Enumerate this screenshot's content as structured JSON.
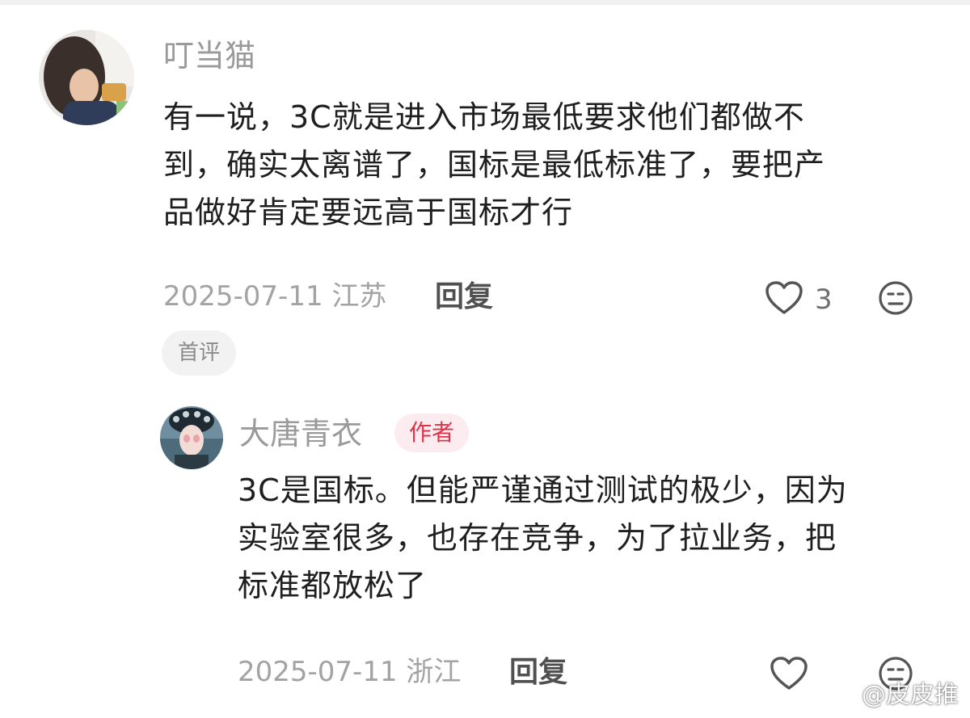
{
  "colors": {
    "username": "#9a9a9a",
    "body_text": "#1f1f1f",
    "meta": "#a3a3a3",
    "author_badge_bg": "#fdecef",
    "author_badge_text": "#e0324b",
    "pill_bg": "#f2f2f2"
  },
  "comment": {
    "username": "叮当猫",
    "text_lines": [
      "有一说，3C就是进入市场最低要求他们都做不",
      "到，确实太离谱了，国标是最低标准了，要把产",
      "品做好肯定要远高于国标才行"
    ],
    "date": "2025-07-11",
    "location": "江苏",
    "reply_label": "回复",
    "like_count": "3",
    "like_icon": "heart-outline-icon",
    "emoji_icon": "neutral-face-icon",
    "tag": "首评"
  },
  "reply": {
    "username": "大唐青衣",
    "badge": "作者",
    "text_lines": [
      "3C是国标。但能严谨通过测试的极少，因为",
      "实验室很多，也存在竞争，为了拉业务，把",
      "标准都放松了"
    ],
    "date": "2025-07-11",
    "location": "浙江",
    "reply_label": "回复",
    "like_icon": "heart-outline-icon",
    "emoji_icon": "neutral-face-icon"
  },
  "watermark": {
    "text": "@皮皮推",
    "icon": "weibo-logo-icon"
  }
}
